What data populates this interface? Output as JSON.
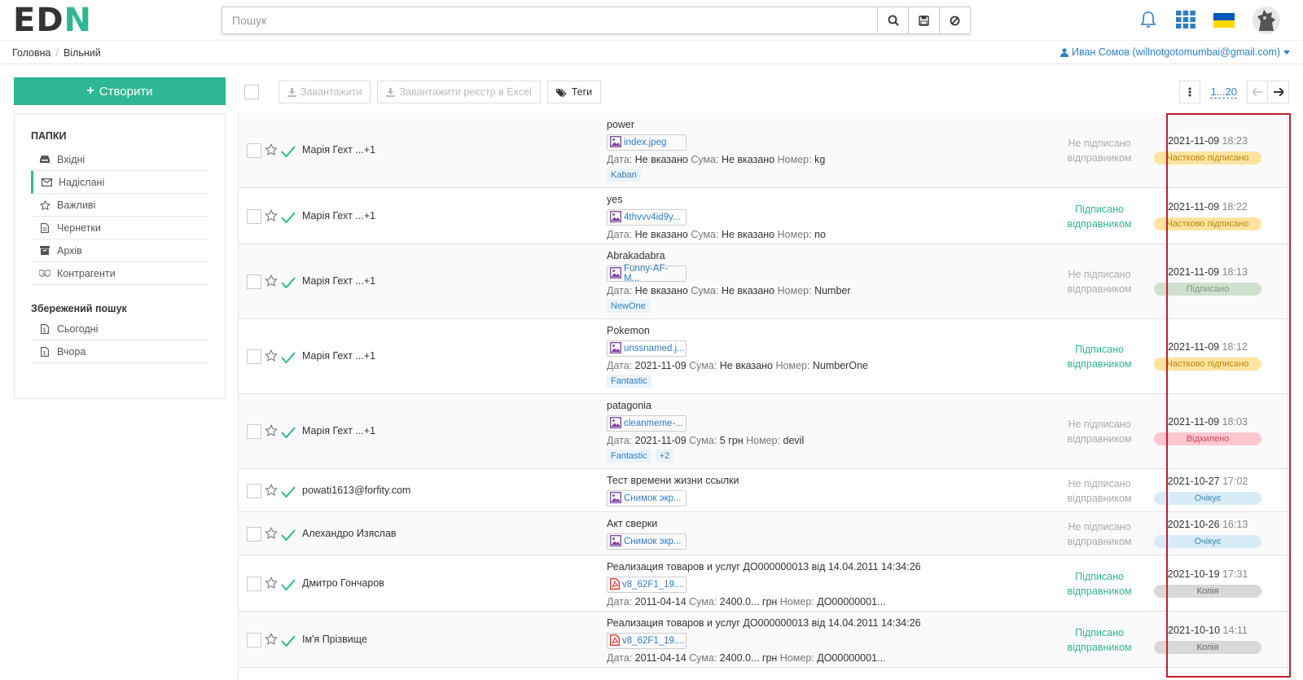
{
  "header": {
    "logo": {
      "a": "ED",
      "b": "N"
    },
    "search_placeholder": "Пошук"
  },
  "breadcrumb": {
    "home": "Головна",
    "current": "Вільний",
    "user": "Иван Сомов (willnotgotomumbai@gmail.com)"
  },
  "sidebar": {
    "create_label": "Створити",
    "folders_title": "ПАПКИ",
    "folders": [
      {
        "label": "Вхідні",
        "icon": "inbox-icon"
      },
      {
        "label": "Надіслані",
        "icon": "envelope-icon",
        "active": true
      },
      {
        "label": "Важливі",
        "icon": "star-icon"
      },
      {
        "label": "Чернетки",
        "icon": "document-icon"
      },
      {
        "label": "Архів",
        "icon": "archive-icon"
      },
      {
        "label": "Контрагенти",
        "icon": "handshake-icon"
      }
    ],
    "saved_title": "Збережений пошук",
    "saved": [
      {
        "label": "Сьогодні",
        "icon": "file-icon"
      },
      {
        "label": "Вчора",
        "icon": "file-icon"
      }
    ]
  },
  "toolbar": {
    "download": "Завантажити",
    "download_excel": "Завантажити реєстр в Excel",
    "tags": "Теги",
    "page_range": "1...20"
  },
  "meta_labels": {
    "date": "Дата:",
    "sum": "Сума:",
    "number": "Номер:"
  },
  "documents": [
    {
      "sender": "Марія Гехт ...+1",
      "title": "power",
      "file": "index.jpeg",
      "file_type": "image",
      "date": "Не вказано",
      "sum": "Не вказано",
      "number": "kg",
      "tags": [
        "Kaban"
      ],
      "signature": "Не підписано відправником",
      "signed": false,
      "status_date": "2021-11-09",
      "status_time": "18:23",
      "status": "Частково підписано",
      "status_kind": "partial"
    },
    {
      "sender": "Марія Гехт ...+1",
      "title": "yes",
      "file": "4thvvv4id9y...",
      "file_type": "image",
      "date": "Не вказано",
      "sum": "Не вказано",
      "number": "no",
      "tags": [],
      "signature": "Підписано відправником",
      "signed": true,
      "status_date": "2021-11-09",
      "status_time": "18:22",
      "status": "Частково підписано",
      "status_kind": "partial"
    },
    {
      "sender": "Марія Гехт ...+1",
      "title": "Abrakadabra",
      "file": "Funny-AF-M...",
      "file_type": "image",
      "date": "Не вказано",
      "sum": "Не вказано",
      "number": "Number",
      "tags": [
        "NewOne"
      ],
      "signature": "Не підписано відправником",
      "signed": false,
      "status_date": "2021-11-09",
      "status_time": "18:13",
      "status": "Підписано",
      "status_kind": "signed"
    },
    {
      "sender": "Марія Гехт ...+1",
      "title": "Pokemon",
      "file": "unssnamed.j...",
      "file_type": "image",
      "date": "2021-11-09",
      "sum": "Не вказано",
      "number": "NumberOne",
      "tags": [
        "Fantastic"
      ],
      "signature": "Підписано відправником",
      "signed": true,
      "status_date": "2021-11-09",
      "status_time": "18:12",
      "status": "Частково підписано",
      "status_kind": "partial"
    },
    {
      "sender": "Марія Гехт ...+1",
      "title": "patagonia",
      "file": "cleanmeme-...",
      "file_type": "image",
      "date": "2021-11-09",
      "sum": "5 грн",
      "number": "devil",
      "tags": [
        "Fantastic",
        "+2"
      ],
      "signature": "Не підписано відправником",
      "signed": false,
      "status_date": "2021-11-09",
      "status_time": "18:03",
      "status": "Відхилено",
      "status_kind": "rejected"
    },
    {
      "sender": "powati1613@forfity.com",
      "title": "Тест времени жизни ссылки",
      "file": "Снимок экр...",
      "file_type": "image",
      "tags": [],
      "signature": "Не підписано відправником",
      "signed": false,
      "status_date": "2021-10-27",
      "status_time": "17:02",
      "status": "Очікує",
      "status_kind": "waiting"
    },
    {
      "sender": "Алехандро Изяслав",
      "title": "Акт сверки",
      "file": "Снимок экр...",
      "file_type": "image",
      "tags": [],
      "signature": "Не підписано відправником",
      "signed": false,
      "status_date": "2021-10-26",
      "status_time": "16:13",
      "status": "Очікує",
      "status_kind": "waiting"
    },
    {
      "sender": "Дмитро Гончаров",
      "title": "Реализация товаров и услуг ДО000000013 від 14.04.2011 14:34:26",
      "file": "v8_62F1_19....",
      "file_type": "pdf",
      "date": "2011-04-14",
      "sum": "2400.0... грн",
      "number": "ДО00000001...",
      "tags": [],
      "signature": "Підписано відправником",
      "signed": true,
      "status_date": "2021-10-19",
      "status_time": "17:31",
      "status": "Копія",
      "status_kind": "copy"
    },
    {
      "sender": "Ім'я Прізвище",
      "title": "Реализация товаров и услуг ДО000000013 від 14.04.2011 14:34:26",
      "file": "v8_62F1_19....",
      "file_type": "pdf",
      "date": "2011-04-14",
      "sum": "2400.0... грн",
      "number": "ДО00000001...",
      "tags": [],
      "signature": "Підписано відправником",
      "signed": true,
      "status_date": "2021-10-10",
      "status_time": "14:11",
      "status": "Копія",
      "status_kind": "copy"
    }
  ],
  "colors": {
    "accent": "#2eb792",
    "link": "#2f7ec1",
    "highlight": "#c0202a"
  }
}
